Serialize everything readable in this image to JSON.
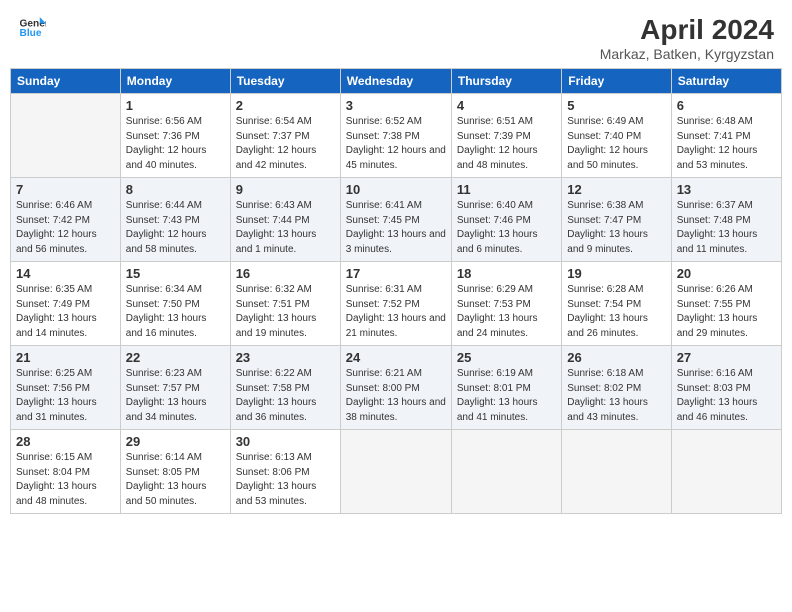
{
  "header": {
    "logo_line1": "General",
    "logo_line2": "Blue",
    "title": "April 2024",
    "subtitle": "Markaz, Batken, Kyrgyzstan"
  },
  "days_of_week": [
    "Sunday",
    "Monday",
    "Tuesday",
    "Wednesday",
    "Thursday",
    "Friday",
    "Saturday"
  ],
  "weeks": [
    [
      {
        "num": "",
        "sunrise": "",
        "sunset": "",
        "daylight": ""
      },
      {
        "num": "1",
        "sunrise": "Sunrise: 6:56 AM",
        "sunset": "Sunset: 7:36 PM",
        "daylight": "Daylight: 12 hours and 40 minutes."
      },
      {
        "num": "2",
        "sunrise": "Sunrise: 6:54 AM",
        "sunset": "Sunset: 7:37 PM",
        "daylight": "Daylight: 12 hours and 42 minutes."
      },
      {
        "num": "3",
        "sunrise": "Sunrise: 6:52 AM",
        "sunset": "Sunset: 7:38 PM",
        "daylight": "Daylight: 12 hours and 45 minutes."
      },
      {
        "num": "4",
        "sunrise": "Sunrise: 6:51 AM",
        "sunset": "Sunset: 7:39 PM",
        "daylight": "Daylight: 12 hours and 48 minutes."
      },
      {
        "num": "5",
        "sunrise": "Sunrise: 6:49 AM",
        "sunset": "Sunset: 7:40 PM",
        "daylight": "Daylight: 12 hours and 50 minutes."
      },
      {
        "num": "6",
        "sunrise": "Sunrise: 6:48 AM",
        "sunset": "Sunset: 7:41 PM",
        "daylight": "Daylight: 12 hours and 53 minutes."
      }
    ],
    [
      {
        "num": "7",
        "sunrise": "Sunrise: 6:46 AM",
        "sunset": "Sunset: 7:42 PM",
        "daylight": "Daylight: 12 hours and 56 minutes."
      },
      {
        "num": "8",
        "sunrise": "Sunrise: 6:44 AM",
        "sunset": "Sunset: 7:43 PM",
        "daylight": "Daylight: 12 hours and 58 minutes."
      },
      {
        "num": "9",
        "sunrise": "Sunrise: 6:43 AM",
        "sunset": "Sunset: 7:44 PM",
        "daylight": "Daylight: 13 hours and 1 minute."
      },
      {
        "num": "10",
        "sunrise": "Sunrise: 6:41 AM",
        "sunset": "Sunset: 7:45 PM",
        "daylight": "Daylight: 13 hours and 3 minutes."
      },
      {
        "num": "11",
        "sunrise": "Sunrise: 6:40 AM",
        "sunset": "Sunset: 7:46 PM",
        "daylight": "Daylight: 13 hours and 6 minutes."
      },
      {
        "num": "12",
        "sunrise": "Sunrise: 6:38 AM",
        "sunset": "Sunset: 7:47 PM",
        "daylight": "Daylight: 13 hours and 9 minutes."
      },
      {
        "num": "13",
        "sunrise": "Sunrise: 6:37 AM",
        "sunset": "Sunset: 7:48 PM",
        "daylight": "Daylight: 13 hours and 11 minutes."
      }
    ],
    [
      {
        "num": "14",
        "sunrise": "Sunrise: 6:35 AM",
        "sunset": "Sunset: 7:49 PM",
        "daylight": "Daylight: 13 hours and 14 minutes."
      },
      {
        "num": "15",
        "sunrise": "Sunrise: 6:34 AM",
        "sunset": "Sunset: 7:50 PM",
        "daylight": "Daylight: 13 hours and 16 minutes."
      },
      {
        "num": "16",
        "sunrise": "Sunrise: 6:32 AM",
        "sunset": "Sunset: 7:51 PM",
        "daylight": "Daylight: 13 hours and 19 minutes."
      },
      {
        "num": "17",
        "sunrise": "Sunrise: 6:31 AM",
        "sunset": "Sunset: 7:52 PM",
        "daylight": "Daylight: 13 hours and 21 minutes."
      },
      {
        "num": "18",
        "sunrise": "Sunrise: 6:29 AM",
        "sunset": "Sunset: 7:53 PM",
        "daylight": "Daylight: 13 hours and 24 minutes."
      },
      {
        "num": "19",
        "sunrise": "Sunrise: 6:28 AM",
        "sunset": "Sunset: 7:54 PM",
        "daylight": "Daylight: 13 hours and 26 minutes."
      },
      {
        "num": "20",
        "sunrise": "Sunrise: 6:26 AM",
        "sunset": "Sunset: 7:55 PM",
        "daylight": "Daylight: 13 hours and 29 minutes."
      }
    ],
    [
      {
        "num": "21",
        "sunrise": "Sunrise: 6:25 AM",
        "sunset": "Sunset: 7:56 PM",
        "daylight": "Daylight: 13 hours and 31 minutes."
      },
      {
        "num": "22",
        "sunrise": "Sunrise: 6:23 AM",
        "sunset": "Sunset: 7:57 PM",
        "daylight": "Daylight: 13 hours and 34 minutes."
      },
      {
        "num": "23",
        "sunrise": "Sunrise: 6:22 AM",
        "sunset": "Sunset: 7:58 PM",
        "daylight": "Daylight: 13 hours and 36 minutes."
      },
      {
        "num": "24",
        "sunrise": "Sunrise: 6:21 AM",
        "sunset": "Sunset: 8:00 PM",
        "daylight": "Daylight: 13 hours and 38 minutes."
      },
      {
        "num": "25",
        "sunrise": "Sunrise: 6:19 AM",
        "sunset": "Sunset: 8:01 PM",
        "daylight": "Daylight: 13 hours and 41 minutes."
      },
      {
        "num": "26",
        "sunrise": "Sunrise: 6:18 AM",
        "sunset": "Sunset: 8:02 PM",
        "daylight": "Daylight: 13 hours and 43 minutes."
      },
      {
        "num": "27",
        "sunrise": "Sunrise: 6:16 AM",
        "sunset": "Sunset: 8:03 PM",
        "daylight": "Daylight: 13 hours and 46 minutes."
      }
    ],
    [
      {
        "num": "28",
        "sunrise": "Sunrise: 6:15 AM",
        "sunset": "Sunset: 8:04 PM",
        "daylight": "Daylight: 13 hours and 48 minutes."
      },
      {
        "num": "29",
        "sunrise": "Sunrise: 6:14 AM",
        "sunset": "Sunset: 8:05 PM",
        "daylight": "Daylight: 13 hours and 50 minutes."
      },
      {
        "num": "30",
        "sunrise": "Sunrise: 6:13 AM",
        "sunset": "Sunset: 8:06 PM",
        "daylight": "Daylight: 13 hours and 53 minutes."
      },
      {
        "num": "",
        "sunrise": "",
        "sunset": "",
        "daylight": ""
      },
      {
        "num": "",
        "sunrise": "",
        "sunset": "",
        "daylight": ""
      },
      {
        "num": "",
        "sunrise": "",
        "sunset": "",
        "daylight": ""
      },
      {
        "num": "",
        "sunrise": "",
        "sunset": "",
        "daylight": ""
      }
    ]
  ]
}
